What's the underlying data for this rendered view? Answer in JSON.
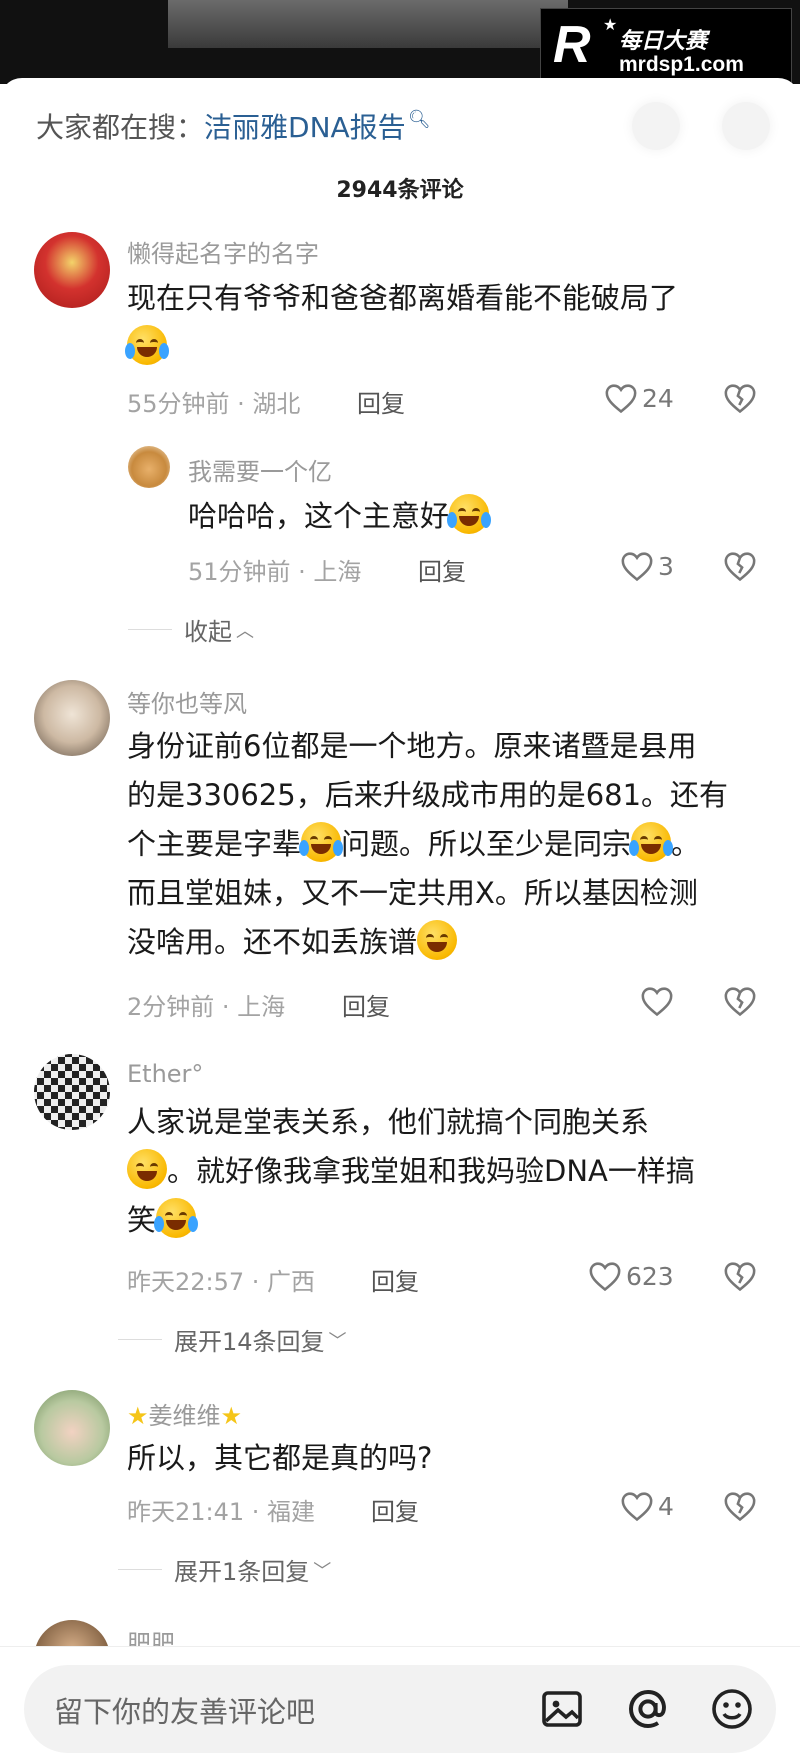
{
  "watermark": {
    "cn": "每日大赛",
    "url": "mrdsp1.com"
  },
  "search": {
    "prefix": "大家都在搜：",
    "term": "洁丽雅DNA报告"
  },
  "comment_count": "2944条评论",
  "comments": [
    {
      "nick": "懒得起名字的名字",
      "text": "现在只有爷爷和爸爸都离婚看能不能破局了",
      "time_loc": "55分钟前 · 湖北",
      "reply": "回复",
      "likes": "24"
    },
    {
      "nick": "我需要一个亿",
      "text": "哈哈哈，这个主意好",
      "time_loc": "51分钟前 · 上海",
      "reply": "回复",
      "likes": "3",
      "collapse": "收起"
    },
    {
      "nick": "等你也等风",
      "line1": "身份证前6位都是一个地方。原来诸暨是县用",
      "line2": "的是330625，后来升级成市用的是681。还有",
      "line3a": "个主要是字辈",
      "line3b": "问题。所以至少是同宗",
      "line3c": "。",
      "line4": "而且堂姐妹，又不一定共用X。所以基因检测",
      "line5": "没啥用。还不如丢族谱",
      "time_loc": "2分钟前 · 上海",
      "reply": "回复",
      "likes": ""
    },
    {
      "nick": "Ether°",
      "line1": "人家说是堂表关系，他们就搞个同胞关系",
      "line2": "。就好像我拿我堂姐和我妈验DNA一样搞",
      "line3": "笑",
      "time_loc": "昨天22:57 · 广西",
      "reply": "回复",
      "likes": "623",
      "expand": "展开14条回复"
    },
    {
      "nick": "姜维维",
      "text": "所以，其它都是真的吗?",
      "time_loc": "昨天21:41 · 福建",
      "reply": "回复",
      "likes": "4",
      "expand": "展开1条回复"
    },
    {
      "nick": "肥肥"
    }
  ],
  "input": {
    "placeholder": "留下你的友善评论吧"
  },
  "icons": [
    "search-icon",
    "heart-icon",
    "broken-heart-icon",
    "image-icon",
    "at-icon",
    "smiley-icon",
    "crying-laughing-emoji",
    "grinning-sweat-emoji"
  ]
}
